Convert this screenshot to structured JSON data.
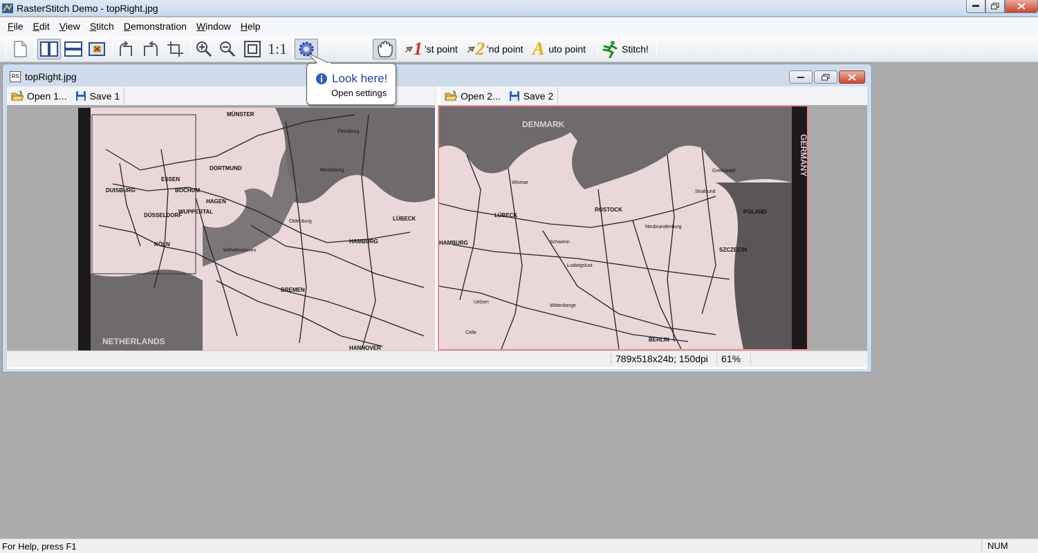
{
  "window": {
    "title": "RasterStitch Demo - topRight.jpg"
  },
  "menu": [
    {
      "label": "File",
      "mnemonic": "F",
      "rest": "ile"
    },
    {
      "label": "Edit",
      "mnemonic": "E",
      "rest": "dit"
    },
    {
      "label": "View",
      "mnemonic": "V",
      "rest": "iew"
    },
    {
      "label": "Stitch",
      "mnemonic": "S",
      "rest": "titch"
    },
    {
      "label": "Demonstration",
      "mnemonic": "D",
      "rest": "emonstration"
    },
    {
      "label": "Window",
      "mnemonic": "W",
      "rest": "indow"
    },
    {
      "label": "Help",
      "mnemonic": "H",
      "rest": "elp"
    }
  ],
  "toolbar": {
    "first_point_num": "1",
    "first_point_label": "'st point",
    "second_point_num": "2",
    "second_point_label": "'nd point",
    "auto_point_letter": "A",
    "auto_point_label": "uto point",
    "stitch_label": "Stitch!",
    "actual_size_label": "1:1"
  },
  "tooltip": {
    "title": "Look here!",
    "text": "Open settings"
  },
  "child_window": {
    "title": "topRight.jpg",
    "icon_text": "RS",
    "left_pane": {
      "open_label": "Open 1...",
      "save_label": "Save 1"
    },
    "right_pane": {
      "open_label": "Open 2...",
      "save_label": "Save 2"
    },
    "status": {
      "image_info": "789x518x24b; 150dpi",
      "zoom": "61%"
    }
  },
  "maps": {
    "left_labels": [
      "MÜNSTER",
      "DORTMUND",
      "BOCHUM",
      "ESSEN",
      "DUISBURG",
      "DÜSSELDORF",
      "WUPPERTAL",
      "HAGEN",
      "KÖLN",
      "HAMBURG",
      "BREMEN",
      "HANNOVER",
      "NETHERLANDS",
      "Flensburg",
      "Rendsburg",
      "LÜBECK",
      "Wilhelmshaven",
      "Oldenburg"
    ],
    "right_labels": [
      "DENMARK",
      "GERMANY",
      "POLAND",
      "ROSTOCK",
      "BERLIN",
      "LÜBECK",
      "HAMBURG",
      "SZCZECIN",
      "Stralsund",
      "Greifswald",
      "Schwerin",
      "Wismar",
      "Neubrandenburg",
      "Wittenberge",
      "Ludwigslust",
      "Celle",
      "Uelzen"
    ]
  },
  "colors": {
    "map_paper": "#e9d7d9",
    "map_sea": "#6f6a6d",
    "frame_selected": "#f08a8a"
  },
  "statusbar": {
    "help": "For Help, press F1",
    "num": "NUM"
  }
}
